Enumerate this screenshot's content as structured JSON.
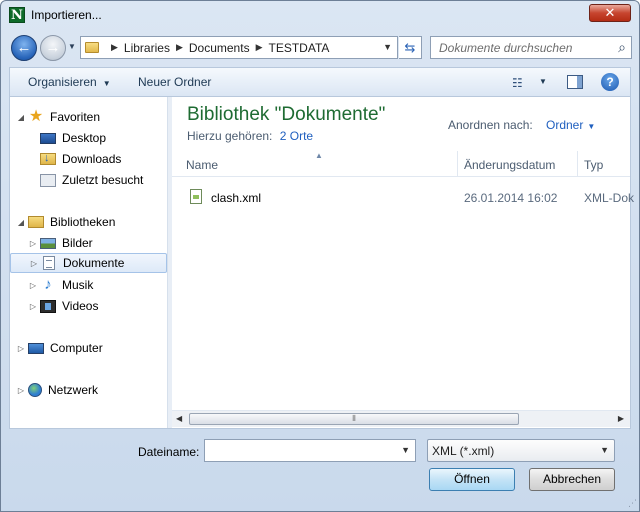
{
  "window": {
    "title": "Importieren...",
    "app_icon_letter": "N",
    "close_label": "✕"
  },
  "address_bar": {
    "crumbs": [
      "Libraries",
      "Documents",
      "TESTDATA"
    ]
  },
  "search": {
    "placeholder": "Dokumente durchsuchen"
  },
  "command_bar": {
    "organize_label": "Organisieren",
    "new_folder_label": "Neuer Ordner",
    "help_label": "?"
  },
  "sidebar": {
    "favorites_label": "Favoriten",
    "favorites_items": [
      "Desktop",
      "Downloads",
      "Zuletzt besucht"
    ],
    "libraries_label": "Bibliotheken",
    "libraries_items": [
      "Bilder",
      "Dokumente",
      "Musik",
      "Videos"
    ],
    "selected": "Dokumente",
    "computer_label": "Computer",
    "network_label": "Netzwerk"
  },
  "content": {
    "title": "Bibliothek \"Dokumente\"",
    "subtitle": "Hierzu gehören:",
    "subtitle_link": "2 Orte",
    "arrange_label": "Anordnen nach:",
    "arrange_value": "Ordner",
    "columns": [
      "Name",
      "Änderungsdatum",
      "Typ"
    ],
    "files": [
      {
        "name": "clash.xml",
        "date": "26.01.2014 16:02",
        "type": "XML-Dok"
      }
    ]
  },
  "footer": {
    "filename_label": "Dateiname:",
    "filename_value": "",
    "filetype_value": "XML (*.xml)",
    "open_label": "Öffnen",
    "cancel_label": "Abbrechen"
  }
}
